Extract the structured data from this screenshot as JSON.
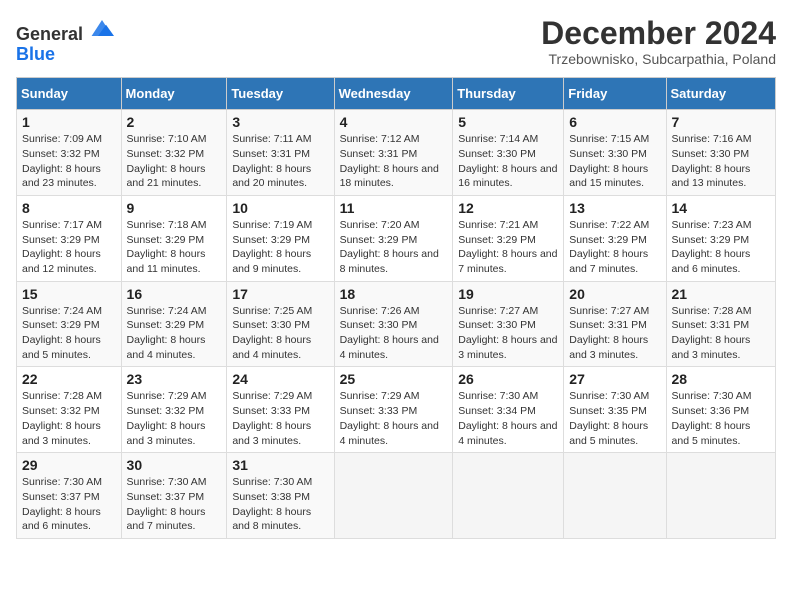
{
  "header": {
    "logo_general": "General",
    "logo_blue": "Blue",
    "title": "December 2024",
    "subtitle": "Trzebownisko, Subcarpathia, Poland"
  },
  "calendar": {
    "days_of_week": [
      "Sunday",
      "Monday",
      "Tuesday",
      "Wednesday",
      "Thursday",
      "Friday",
      "Saturday"
    ],
    "weeks": [
      [
        {
          "day": "1",
          "sunrise": "7:09 AM",
          "sunset": "3:32 PM",
          "daylight": "8 hours and 23 minutes."
        },
        {
          "day": "2",
          "sunrise": "7:10 AM",
          "sunset": "3:32 PM",
          "daylight": "8 hours and 21 minutes."
        },
        {
          "day": "3",
          "sunrise": "7:11 AM",
          "sunset": "3:31 PM",
          "daylight": "8 hours and 20 minutes."
        },
        {
          "day": "4",
          "sunrise": "7:12 AM",
          "sunset": "3:31 PM",
          "daylight": "8 hours and 18 minutes."
        },
        {
          "day": "5",
          "sunrise": "7:14 AM",
          "sunset": "3:30 PM",
          "daylight": "8 hours and 16 minutes."
        },
        {
          "day": "6",
          "sunrise": "7:15 AM",
          "sunset": "3:30 PM",
          "daylight": "8 hours and 15 minutes."
        },
        {
          "day": "7",
          "sunrise": "7:16 AM",
          "sunset": "3:30 PM",
          "daylight": "8 hours and 13 minutes."
        }
      ],
      [
        {
          "day": "8",
          "sunrise": "7:17 AM",
          "sunset": "3:29 PM",
          "daylight": "8 hours and 12 minutes."
        },
        {
          "day": "9",
          "sunrise": "7:18 AM",
          "sunset": "3:29 PM",
          "daylight": "8 hours and 11 minutes."
        },
        {
          "day": "10",
          "sunrise": "7:19 AM",
          "sunset": "3:29 PM",
          "daylight": "8 hours and 9 minutes."
        },
        {
          "day": "11",
          "sunrise": "7:20 AM",
          "sunset": "3:29 PM",
          "daylight": "8 hours and 8 minutes."
        },
        {
          "day": "12",
          "sunrise": "7:21 AM",
          "sunset": "3:29 PM",
          "daylight": "8 hours and 7 minutes."
        },
        {
          "day": "13",
          "sunrise": "7:22 AM",
          "sunset": "3:29 PM",
          "daylight": "8 hours and 7 minutes."
        },
        {
          "day": "14",
          "sunrise": "7:23 AM",
          "sunset": "3:29 PM",
          "daylight": "8 hours and 6 minutes."
        }
      ],
      [
        {
          "day": "15",
          "sunrise": "7:24 AM",
          "sunset": "3:29 PM",
          "daylight": "8 hours and 5 minutes."
        },
        {
          "day": "16",
          "sunrise": "7:24 AM",
          "sunset": "3:29 PM",
          "daylight": "8 hours and 4 minutes."
        },
        {
          "day": "17",
          "sunrise": "7:25 AM",
          "sunset": "3:30 PM",
          "daylight": "8 hours and 4 minutes."
        },
        {
          "day": "18",
          "sunrise": "7:26 AM",
          "sunset": "3:30 PM",
          "daylight": "8 hours and 4 minutes."
        },
        {
          "day": "19",
          "sunrise": "7:27 AM",
          "sunset": "3:30 PM",
          "daylight": "8 hours and 3 minutes."
        },
        {
          "day": "20",
          "sunrise": "7:27 AM",
          "sunset": "3:31 PM",
          "daylight": "8 hours and 3 minutes."
        },
        {
          "day": "21",
          "sunrise": "7:28 AM",
          "sunset": "3:31 PM",
          "daylight": "8 hours and 3 minutes."
        }
      ],
      [
        {
          "day": "22",
          "sunrise": "7:28 AM",
          "sunset": "3:32 PM",
          "daylight": "8 hours and 3 minutes."
        },
        {
          "day": "23",
          "sunrise": "7:29 AM",
          "sunset": "3:32 PM",
          "daylight": "8 hours and 3 minutes."
        },
        {
          "day": "24",
          "sunrise": "7:29 AM",
          "sunset": "3:33 PM",
          "daylight": "8 hours and 3 minutes."
        },
        {
          "day": "25",
          "sunrise": "7:29 AM",
          "sunset": "3:33 PM",
          "daylight": "8 hours and 4 minutes."
        },
        {
          "day": "26",
          "sunrise": "7:30 AM",
          "sunset": "3:34 PM",
          "daylight": "8 hours and 4 minutes."
        },
        {
          "day": "27",
          "sunrise": "7:30 AM",
          "sunset": "3:35 PM",
          "daylight": "8 hours and 5 minutes."
        },
        {
          "day": "28",
          "sunrise": "7:30 AM",
          "sunset": "3:36 PM",
          "daylight": "8 hours and 5 minutes."
        }
      ],
      [
        {
          "day": "29",
          "sunrise": "7:30 AM",
          "sunset": "3:37 PM",
          "daylight": "8 hours and 6 minutes."
        },
        {
          "day": "30",
          "sunrise": "7:30 AM",
          "sunset": "3:37 PM",
          "daylight": "8 hours and 7 minutes."
        },
        {
          "day": "31",
          "sunrise": "7:30 AM",
          "sunset": "3:38 PM",
          "daylight": "8 hours and 8 minutes."
        },
        null,
        null,
        null,
        null
      ]
    ],
    "labels": {
      "sunrise": "Sunrise:",
      "sunset": "Sunset:",
      "daylight": "Daylight:"
    }
  }
}
